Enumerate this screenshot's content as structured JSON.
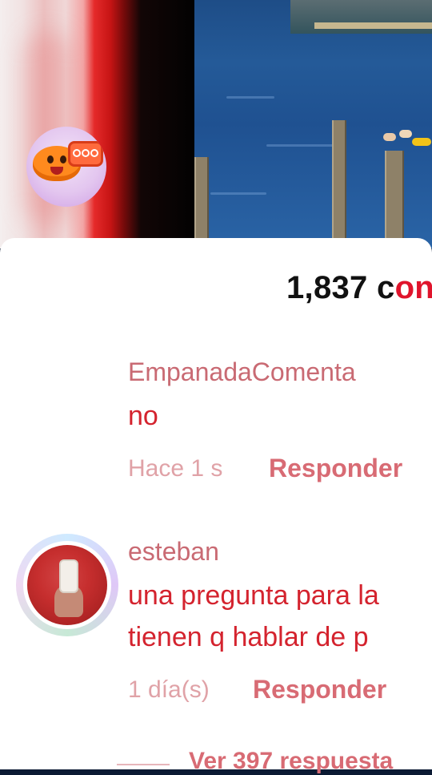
{
  "comments_header": {
    "count": "1,837",
    "label_prefix": "c",
    "label_accent": "on"
  },
  "comments": [
    {
      "username": "EmpanadaComenta",
      "text_lines": [
        "no"
      ],
      "time": "Hace 1 s",
      "reply_label": "Responder"
    },
    {
      "username": "esteban",
      "text_lines": [
        "una pregunta para la",
        "tienen q hablar de p"
      ],
      "time": "1 día(s)",
      "reply_label": "Responder",
      "view_replies_label": "Ver 397 respuesta"
    }
  ],
  "icons": {
    "avatar_1": "empanada-mascot-avatar-icon",
    "avatar_2": "selfie-photo-avatar"
  },
  "colors": {
    "accent_red": "#e0142c",
    "username": "#c96a73",
    "comment_text": "#d4232e",
    "timestamp": "#e0a2a7",
    "reply": "#d86b74"
  }
}
